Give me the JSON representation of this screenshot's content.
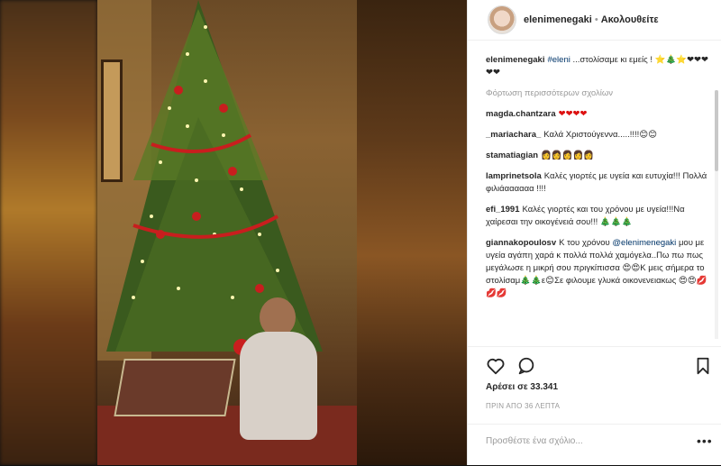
{
  "header": {
    "username": "elenimenegaki",
    "separator": "•",
    "follow_label": "Ακολουθείτε"
  },
  "caption": {
    "username": "elenimenegaki",
    "tag": "#eleni",
    "text": " ...στολίσαμε κι εμείς !",
    "emojis": "⭐🎄⭐❤❤❤❤❤"
  },
  "load_more_label": "Φόρτωση περισσότερων σχολίων",
  "comments": [
    {
      "user": "magda.chantzara",
      "text": "❤❤❤❤"
    },
    {
      "user": "_mariachara_",
      "text": "Καλά Χριστούγεννα.....!!!!😊😊"
    },
    {
      "user": "stamatiagian",
      "text": "👩👩👩👩👩"
    },
    {
      "user": "lamprinetsola",
      "text": "Καλές γιορτές με υγεία και ευτυχία!!! Πολλά φιλιάαααααα !!!!"
    },
    {
      "user": "efi_1991",
      "text": "Καλές γιορτές και του χρόνου με υγεία!!!Να χαίρεσαι την οικογένειά σου!!! 🎄🎄🎄"
    },
    {
      "user": "giannakopoulosv",
      "text_before": "Κ του χρόνου ",
      "mention": "@elenimenegaki",
      "text_after": " μου με υγεία αγάπη χαρά κ πολλά πολλά χαμόγελα..Πω πω πως μεγάλωσε η μικρή σου πριγκίπισσα 😍😍Κ μεις σήμερα το στολίσαμ🎄🎄ε😊Σε φιλουμε γλυκά οικονενειακως 😍😍💋💋💋"
    }
  ],
  "likes_label": "Αρέσει σε 33.341",
  "time_label": "ΠΡΙΝ ΑΠΟ 36 ΛΕΠΤΑ",
  "add_comment_placeholder": "Προσθέστε ένα σχόλιο...",
  "more_options": "•••",
  "icons": {
    "like": "heart-icon",
    "comment": "comment-icon",
    "save": "bookmark-icon"
  },
  "colors": {
    "link": "#003569",
    "text": "#262626",
    "muted": "#999999"
  }
}
